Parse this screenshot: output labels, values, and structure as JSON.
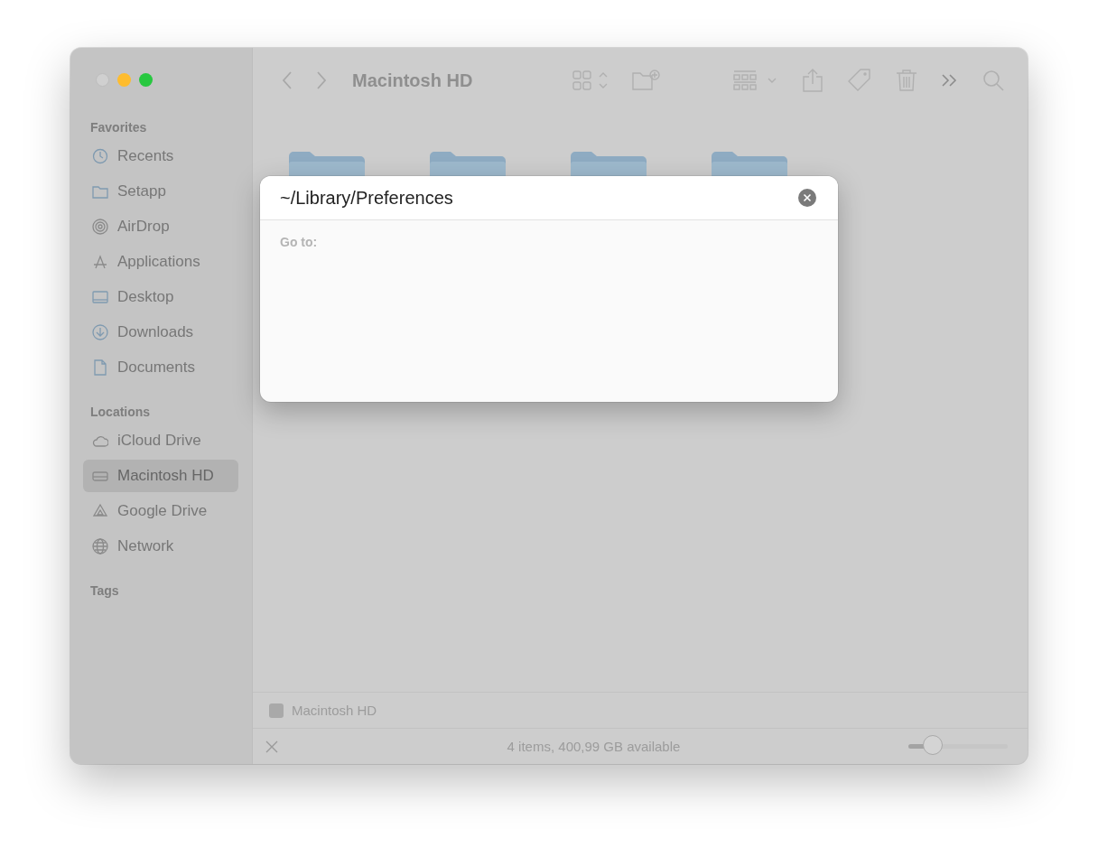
{
  "window": {
    "title": "Macintosh HD"
  },
  "sidebar": {
    "sections": [
      {
        "heading": "Favorites",
        "items": [
          {
            "label": "Recents",
            "selected": false
          },
          {
            "label": "Setapp",
            "selected": false
          },
          {
            "label": "AirDrop",
            "selected": false
          },
          {
            "label": "Applications",
            "selected": false
          },
          {
            "label": "Desktop",
            "selected": false
          },
          {
            "label": "Downloads",
            "selected": false
          },
          {
            "label": "Documents",
            "selected": false
          }
        ]
      },
      {
        "heading": "Locations",
        "items": [
          {
            "label": "iCloud Drive",
            "selected": false
          },
          {
            "label": "Macintosh HD",
            "selected": true
          },
          {
            "label": "Google Drive",
            "selected": false
          },
          {
            "label": "Network",
            "selected": false
          }
        ]
      },
      {
        "heading": "Tags"
      }
    ]
  },
  "go_to_dialog": {
    "value": "~/Library/Preferences",
    "label": "Go to:"
  },
  "path_bar": {
    "label": "Macintosh HD"
  },
  "status_bar": {
    "text": "4 items, 400,99 GB available",
    "zoom": {
      "level": 0.25
    }
  }
}
